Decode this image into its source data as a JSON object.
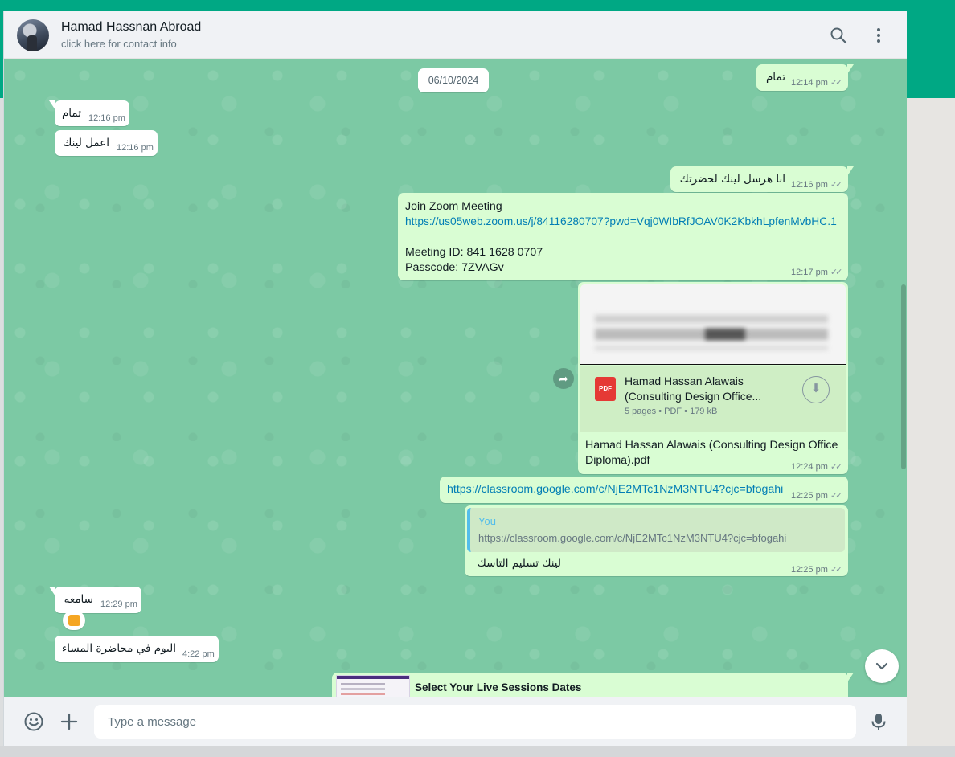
{
  "header": {
    "contact_name": "Hamad Hassnan Abroad",
    "contact_sub": "click here for contact info",
    "icons": [
      "search-icon",
      "menu-dots-icon"
    ]
  },
  "chat": {
    "date_chip": "06/10/2024",
    "messages": [
      {
        "dir": "out",
        "text": "تمام",
        "time": "12:14 pm"
      },
      {
        "dir": "in",
        "text": "تمام",
        "time": "12:16 pm"
      },
      {
        "dir": "in",
        "text": "اعمل لينك",
        "time": "12:16 pm"
      },
      {
        "dir": "out",
        "text": "انا هرسل لينك لحضرتك",
        "time": "12:16 pm"
      },
      {
        "dir": "out",
        "lines": [
          "Join Zoom Meeting",
          "https://us05web.zoom.us/j/84116280707?pwd=Vqj0WIbRfJOAV0K2KbkhLpfenMvbHC.1",
          "",
          "Meeting ID: 841 1628 0707",
          "Passcode: 7ZVAGv"
        ],
        "time": "12:17 pm"
      },
      {
        "dir": "out",
        "type": "document",
        "doc_title_1": "Hamad Hassan Alawais",
        "doc_title_2": "(Consulting Design Office...",
        "doc_info": "5 pages • PDF • 179 kB",
        "pdf_label": "PDF",
        "caption_1": "Hamad Hassan Alawais (Consulting Design Office",
        "caption_2": "Diploma).pdf",
        "time": "12:24 pm"
      },
      {
        "dir": "out",
        "text": "https://classroom.google.com/c/NjE2MTc1NzM3NTU4?cjc=bfogahi",
        "time": "12:25 pm"
      },
      {
        "dir": "out",
        "type": "reply",
        "quote_author": "You",
        "quote_text": "https://classroom.google.com/c/NjE2MTc1NzM3NTU4?cjc=bfogahi",
        "text": "لينك تسليم التاسك",
        "time": "12:25 pm"
      },
      {
        "dir": "in",
        "text": "سامعه",
        "time": "12:29 pm",
        "reaction": "thumbs-up"
      },
      {
        "dir": "in",
        "text": "اليوم في محاضرة المساء",
        "time": "4:22 pm"
      },
      {
        "dir": "out",
        "type": "link-preview",
        "text": "Select Your Live Sessions Dates"
      }
    ]
  },
  "footer": {
    "placeholder": "Type a message",
    "icons": [
      "emoji-icon",
      "plus-icon",
      "microphone-icon"
    ]
  },
  "colors": {
    "brand": "#00a884",
    "chat_bg": "#7cc9a4",
    "outgoing_bubble": "#d9fdd3",
    "incoming_bubble": "#ffffff",
    "link": "#027eb5"
  }
}
